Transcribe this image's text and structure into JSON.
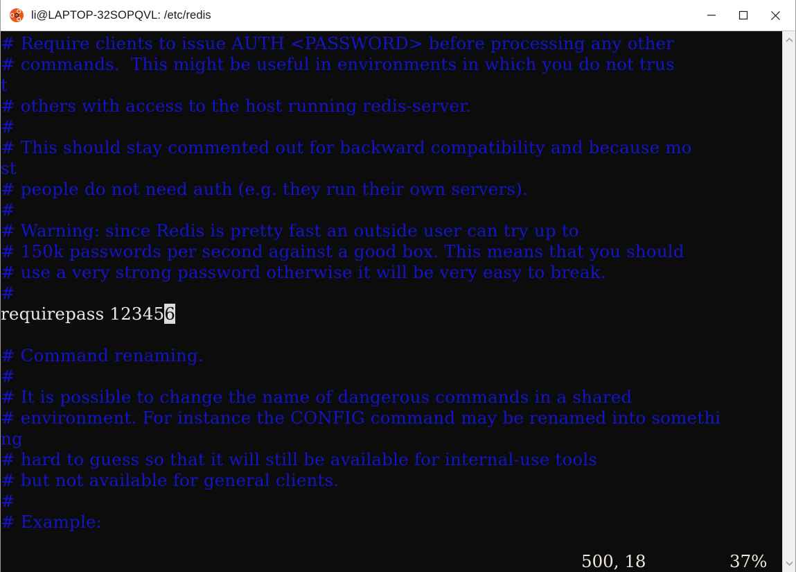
{
  "window": {
    "title": "li@LAPTOP-32SOPQVL: /etc/redis",
    "icon": "ubuntu-icon",
    "minimize_label": "Minimize",
    "maximize_label": "Maximize",
    "close_label": "Close"
  },
  "colors": {
    "terminal_bg": "#0c0c0c",
    "comment_blue": "#1414c8",
    "text_white": "#e8e8e8",
    "status_text": "#efe8dc",
    "cursor_bg": "#dcdcdc",
    "titlebar_bg": "#ffffff",
    "scrollbar_bg": "#f0f0f0",
    "ubuntu_orange": "#e9581f"
  },
  "terminal": {
    "lines": [
      {
        "text": "# Require clients to issue AUTH <PASSWORD> before processing any other",
        "style": "comment"
      },
      {
        "text": "# commands.  This might be useful in environments in which you do not trus",
        "style": "comment"
      },
      {
        "text": "t",
        "style": "comment"
      },
      {
        "text": "# others with access to the host running redis-server.",
        "style": "comment"
      },
      {
        "text": "#",
        "style": "comment"
      },
      {
        "text": "# This should stay commented out for backward compatibility and because mo",
        "style": "comment"
      },
      {
        "text": "st",
        "style": "comment"
      },
      {
        "text": "# people do not need auth (e.g. they run their own servers).",
        "style": "comment"
      },
      {
        "text": "#",
        "style": "comment"
      },
      {
        "text": "# Warning: since Redis is pretty fast an outside user can try up to",
        "style": "comment"
      },
      {
        "text": "# 150k passwords per second against a good box. This means that you should",
        "style": "comment"
      },
      {
        "text": "# use a very strong password otherwise it will be very easy to break.",
        "style": "comment"
      },
      {
        "text": "#",
        "style": "comment"
      },
      {
        "text": "requirepass 12345",
        "style": "text",
        "cursor_char": "6"
      },
      {
        "text": "",
        "style": "comment"
      },
      {
        "text": "# Command renaming.",
        "style": "comment"
      },
      {
        "text": "#",
        "style": "comment"
      },
      {
        "text": "# It is possible to change the name of dangerous commands in a shared",
        "style": "comment"
      },
      {
        "text": "# environment. For instance the CONFIG command may be renamed into somethi",
        "style": "comment"
      },
      {
        "text": "ng",
        "style": "comment"
      },
      {
        "text": "# hard to guess so that it will still be available for internal-use tools",
        "style": "comment"
      },
      {
        "text": "# but not available for general clients.",
        "style": "comment"
      },
      {
        "text": "#",
        "style": "comment"
      },
      {
        "text": "# Example:",
        "style": "comment"
      }
    ],
    "status": {
      "position": "500, 18",
      "percent": "37%"
    }
  },
  "scrollbar": {
    "up_arrow": "chevron-up-icon",
    "down_arrow": "chevron-down-icon"
  }
}
